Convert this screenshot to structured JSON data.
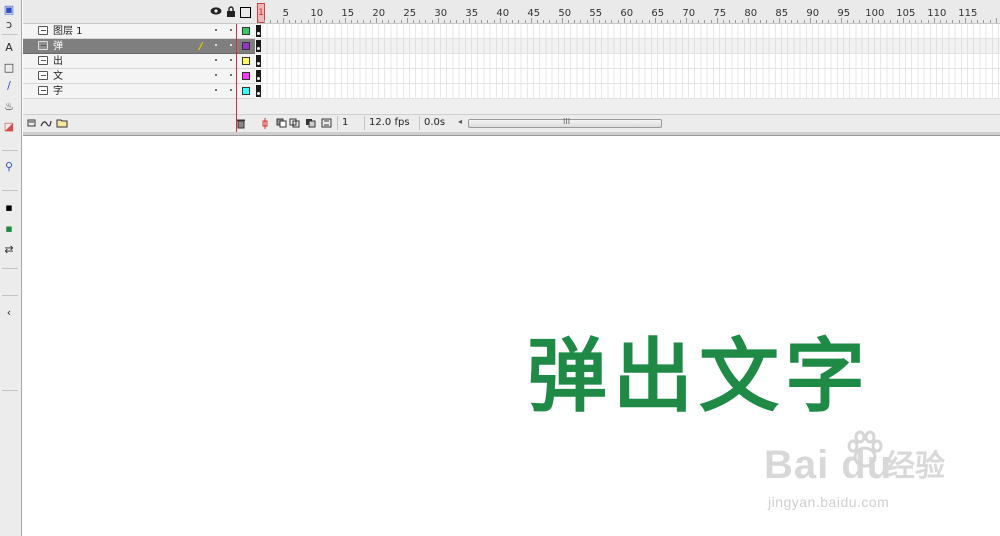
{
  "tools": [
    {
      "name": "subselection-tool-icon",
      "glyph": "▣"
    },
    {
      "name": "lasso-tool-icon",
      "glyph": "ↄ"
    },
    {
      "name": "text-tool-icon",
      "glyph": "A"
    },
    {
      "name": "rectangle-tool-icon",
      "glyph": "□"
    },
    {
      "name": "pencil-tool-icon",
      "glyph": "/"
    },
    {
      "name": "ink-bottle-tool-icon",
      "glyph": "♨"
    },
    {
      "name": "eraser-tool-icon",
      "glyph": "◪"
    },
    {
      "name": "zoom-tool-icon",
      "glyph": "⚲"
    },
    {
      "name": "stroke-color-icon",
      "glyph": "▪"
    },
    {
      "name": "fill-color-icon",
      "glyph": "▪"
    },
    {
      "name": "swap-colors-icon",
      "glyph": "⇄"
    },
    {
      "name": "options-icon",
      "glyph": "‹"
    }
  ],
  "timeline": {
    "header_icons": {
      "eye": "eye-icon",
      "lock": "lock-icon",
      "outline": "outline-icon"
    },
    "layers": [
      {
        "name": "图层 1",
        "color": "#33cc66",
        "selected": false
      },
      {
        "name": "弹",
        "color": "#9933cc",
        "selected": true
      },
      {
        "name": "出",
        "color": "#ffff66",
        "selected": false
      },
      {
        "name": "文",
        "color": "#ff33ff",
        "selected": false
      },
      {
        "name": "字",
        "color": "#33ffff",
        "selected": false
      }
    ],
    "ruler_labels": [
      "1",
      "5",
      "10",
      "15",
      "20",
      "25",
      "30",
      "35",
      "40",
      "45",
      "50",
      "55",
      "60",
      "65",
      "70",
      "75",
      "80",
      "85",
      "90",
      "95",
      "100",
      "105",
      "110",
      "115"
    ],
    "current_frame": "1",
    "frame_rate": "12.0 fps",
    "elapsed_time": "0.0s",
    "scroll_grip": "III",
    "scroll_left": "◂"
  },
  "stage": {
    "text": "弹出文字",
    "text_color": "#1e8a46"
  },
  "watermark": {
    "logo": "Bai du",
    "chinese": "经验",
    "url": "jingyan.baidu.com"
  }
}
